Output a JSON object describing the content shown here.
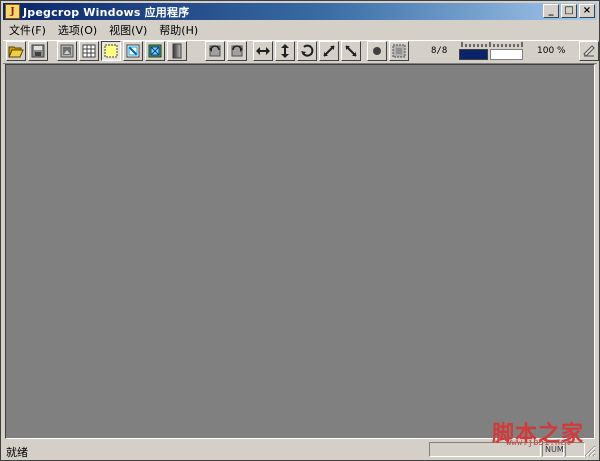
{
  "window": {
    "title": "Jpegcrop Windows 应用程序",
    "app_icon_letter": "J",
    "minimize_glyph": "_",
    "maximize_glyph": "□",
    "close_glyph": "×"
  },
  "menu": [
    "文件(F)",
    "选项(O)",
    "视图(V)",
    "帮助(H)"
  ],
  "toolbar": {
    "buttons": [
      {
        "name": "open-icon"
      },
      {
        "name": "save-icon"
      },
      {
        "name": "copy-image-icon"
      },
      {
        "name": "grid-icon"
      },
      {
        "name": "select-area-icon"
      },
      {
        "name": "crop-frame-icon"
      },
      {
        "name": "crop-fit-icon"
      },
      {
        "name": "gradient-strip-icon"
      },
      {
        "name": "rotate-left-icon"
      },
      {
        "name": "rotate-right-icon"
      },
      {
        "name": "flip-horizontal-icon"
      },
      {
        "name": "flip-vertical-icon"
      },
      {
        "name": "rotate-180-icon"
      },
      {
        "name": "transpose-icon"
      },
      {
        "name": "transverse-icon"
      },
      {
        "name": "circle-icon"
      },
      {
        "name": "frame-icon"
      }
    ],
    "pressed_index": 4,
    "ratio": "8/8",
    "zoom": "100 %",
    "quality_level": 0.45
  },
  "status": {
    "text": "就绪",
    "num": "NUM"
  },
  "watermark": {
    "text": "脚本之家",
    "url": "www.jb51.net"
  },
  "colors": {
    "canvas": "#808080",
    "title_start": "#0a246a",
    "title_end": "#a6caf0",
    "face": "#d4d0c8"
  }
}
